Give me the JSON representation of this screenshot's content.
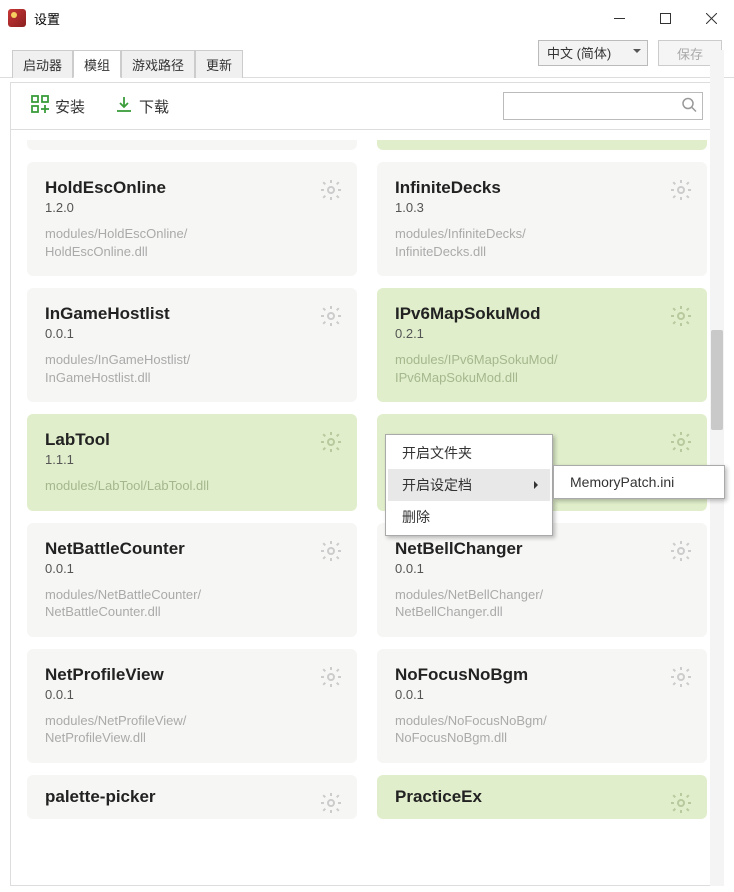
{
  "window": {
    "title": "设置"
  },
  "topbar": {
    "tabs": [
      "启动器",
      "模组",
      "游戏路径",
      "更新"
    ],
    "active_tab": 1,
    "lang": "中文 (简体)",
    "save": "保存"
  },
  "toolbar": {
    "install": "安装",
    "download": "下载",
    "search_placeholder": ""
  },
  "cards": [
    {
      "name": "HoldEscOnline",
      "ver": "1.2.0",
      "path": "modules/HoldEscOnline/HoldEscOnline.dll",
      "enabled": false
    },
    {
      "name": "InfiniteDecks",
      "ver": "1.0.3",
      "path": "modules/InfiniteDecks/InfiniteDecks.dll",
      "enabled": false
    },
    {
      "name": "InGameHostlist",
      "ver": "0.0.1",
      "path": "modules/InGameHostlist/InGameHostlist.dll",
      "enabled": false
    },
    {
      "name": "IPv6MapSokuMod",
      "ver": "0.2.1",
      "path": "modules/IPv6MapSokuMod/IPv6MapSokuMod.dll",
      "enabled": true
    },
    {
      "name": "LabTool",
      "ver": "1.1.1",
      "path": "modules/LabTool/LabTool.dll",
      "enabled": true
    },
    {
      "name": "",
      "ver": "",
      "path": "",
      "enabled": true
    },
    {
      "name": "NetBattleCounter",
      "ver": "0.0.1",
      "path": "modules/NetBattleCounter/NetBattleCounter.dll",
      "enabled": false
    },
    {
      "name": "NetBellChanger",
      "ver": "0.0.1",
      "path": "modules/NetBellChanger/NetBellChanger.dll",
      "enabled": false
    },
    {
      "name": "NetProfileView",
      "ver": "0.0.1",
      "path": "modules/NetProfileView/NetProfileView.dll",
      "enabled": false
    },
    {
      "name": "NoFocusNoBgm",
      "ver": "0.0.1",
      "path": "modules/NoFocusNoBgm/NoFocusNoBgm.dll",
      "enabled": false
    },
    {
      "name": "palette-picker",
      "ver": "",
      "path": "",
      "enabled": false
    },
    {
      "name": "PracticeEx",
      "ver": "",
      "path": "",
      "enabled": true
    }
  ],
  "context_menu": {
    "items": [
      "开启文件夹",
      "开启设定档",
      "删除"
    ],
    "hovered": 1,
    "submenu": [
      "MemoryPatch.ini"
    ]
  }
}
